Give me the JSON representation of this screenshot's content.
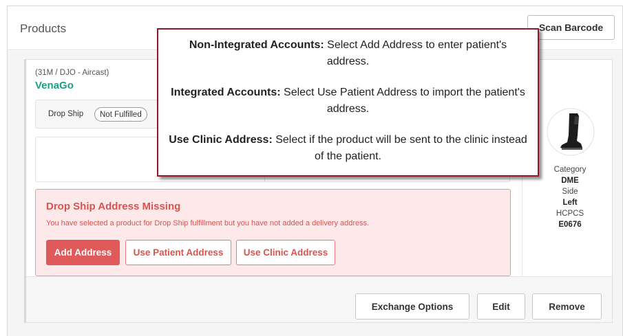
{
  "header": {
    "title": "Products",
    "scan_button": "Scan Barcode"
  },
  "product": {
    "meta": "(31M / DJO - Aircast)",
    "name": "VenaGo",
    "ship_label": "Drop Ship",
    "ship_status": "Not Fulfilled",
    "image_icon": "walker-boot-icon",
    "category_label": "Category",
    "category_value": "DME",
    "side_label": "Side",
    "side_value": "Left",
    "hcpcs_label": "HCPCS",
    "hcpcs_value": "E0676"
  },
  "alert": {
    "title": "Drop Ship Address Missing",
    "text": "You have selected a product for Drop Ship fulfillment but you have not added a delivery address.",
    "add_address": "Add Address",
    "use_patient_address": "Use Patient Address",
    "use_clinic_address": "Use Clinic Address"
  },
  "footer": {
    "exchange": "Exchange Options",
    "edit": "Edit",
    "remove": "Remove"
  },
  "callout": {
    "p1_bold": "Non-Integrated Accounts:",
    "p1_text": " Select Add Address to enter patient's address.",
    "p2_bold": "Integrated Accounts:",
    "p2_text": " Select Use Patient Address to import the patient's address.",
    "p3_bold": "Use Clinic Address:",
    "p3_text": " Select if the product will be sent to the clinic instead of the patient."
  },
  "colors": {
    "accent_green": "#1aa085",
    "alert_red": "#d9534f",
    "callout_border": "#8b1a2b"
  }
}
